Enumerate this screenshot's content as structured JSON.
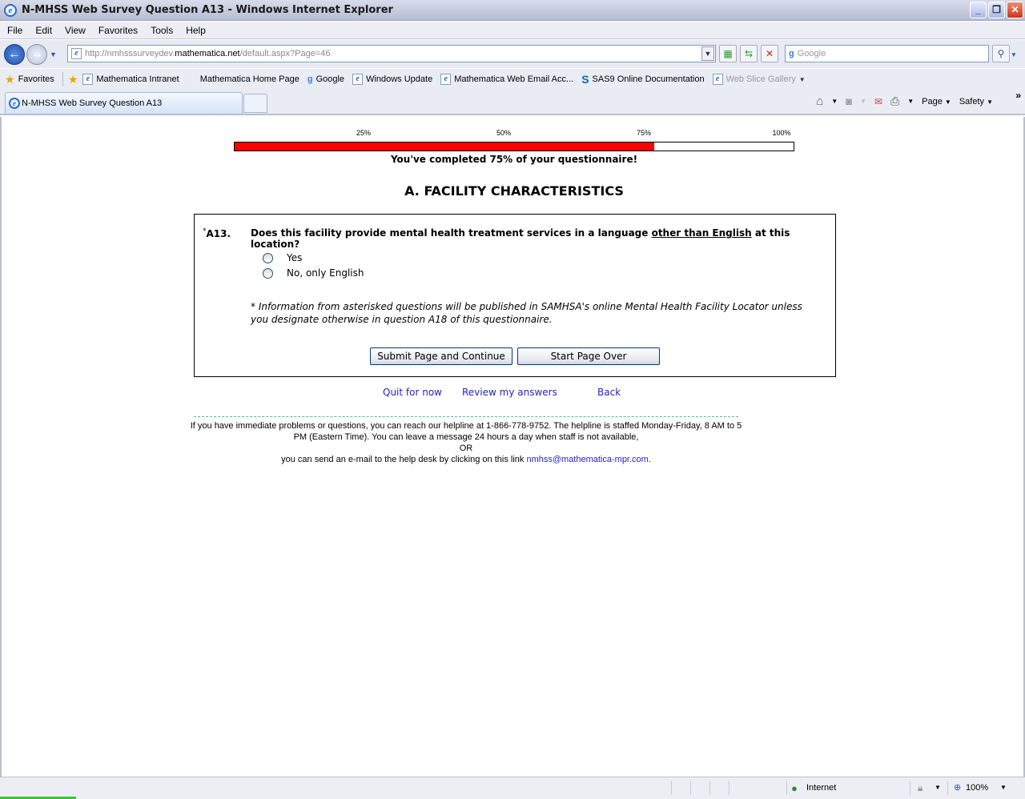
{
  "window": {
    "title": "N-MHSS Web Survey Question A13 - Windows Internet Explorer",
    "minimize": "_",
    "restore": "❐",
    "close": "✕"
  },
  "menu": [
    "File",
    "Edit",
    "View",
    "Favorites",
    "Tools",
    "Help"
  ],
  "address": {
    "prefix": "http://nmhsssurveydev.",
    "host": "mathematica.net",
    "path": "/default.aspx?Page=46"
  },
  "search": {
    "placeholder": "Google"
  },
  "favorites": {
    "label": "Favorites",
    "items": [
      "Mathematica Intranet",
      "Mathematica Home Page",
      "Google",
      "Windows Update",
      "Mathematica Web Email Acc...",
      "SAS9 Online Documentation",
      "Web Slice Gallery"
    ]
  },
  "tab": {
    "label": "N-MHSS Web Survey Question A13"
  },
  "commands": {
    "page": "Page",
    "safety": "Safety",
    "more": "»"
  },
  "progress": {
    "ticks": [
      "25%",
      "50%",
      "75%",
      "100%"
    ],
    "percent": 75,
    "text": "You've completed 75% of your questionnaire!"
  },
  "section_title": "A. FACILITY CHARACTERISTICS",
  "question": {
    "asterisk": "*",
    "number": "A13.",
    "text_before": "Does this facility provide mental health treatment services in a language ",
    "text_underlined": "other than English",
    "text_after": " at this location?",
    "options": [
      "Yes",
      "No, only English"
    ],
    "note": "* Information from asterisked questions will be published in SAMHSA's online Mental Health Facility Locator unless you designate otherwise in question A18 of this questionnaire."
  },
  "buttons": {
    "submit": "Submit Page and Continue",
    "start_over": "Start Page Over"
  },
  "links": {
    "quit": "Quit for now",
    "review": "Review my answers",
    "back": "Back"
  },
  "help": {
    "line1": "If you have immediate problems or questions, you can reach our helpline at 1-866-778-9752. The helpline is staffed Monday-Friday, 8 AM to 5 PM (Eastern Time). You can leave a message 24 hours a day when staff is not available,",
    "or": "OR",
    "line2": "you can send an e-mail to the help desk by clicking on this link ",
    "email": "nmhss@mathematica-mpr.com."
  },
  "statusbar": {
    "zone": "Internet",
    "zoom": "100%"
  }
}
